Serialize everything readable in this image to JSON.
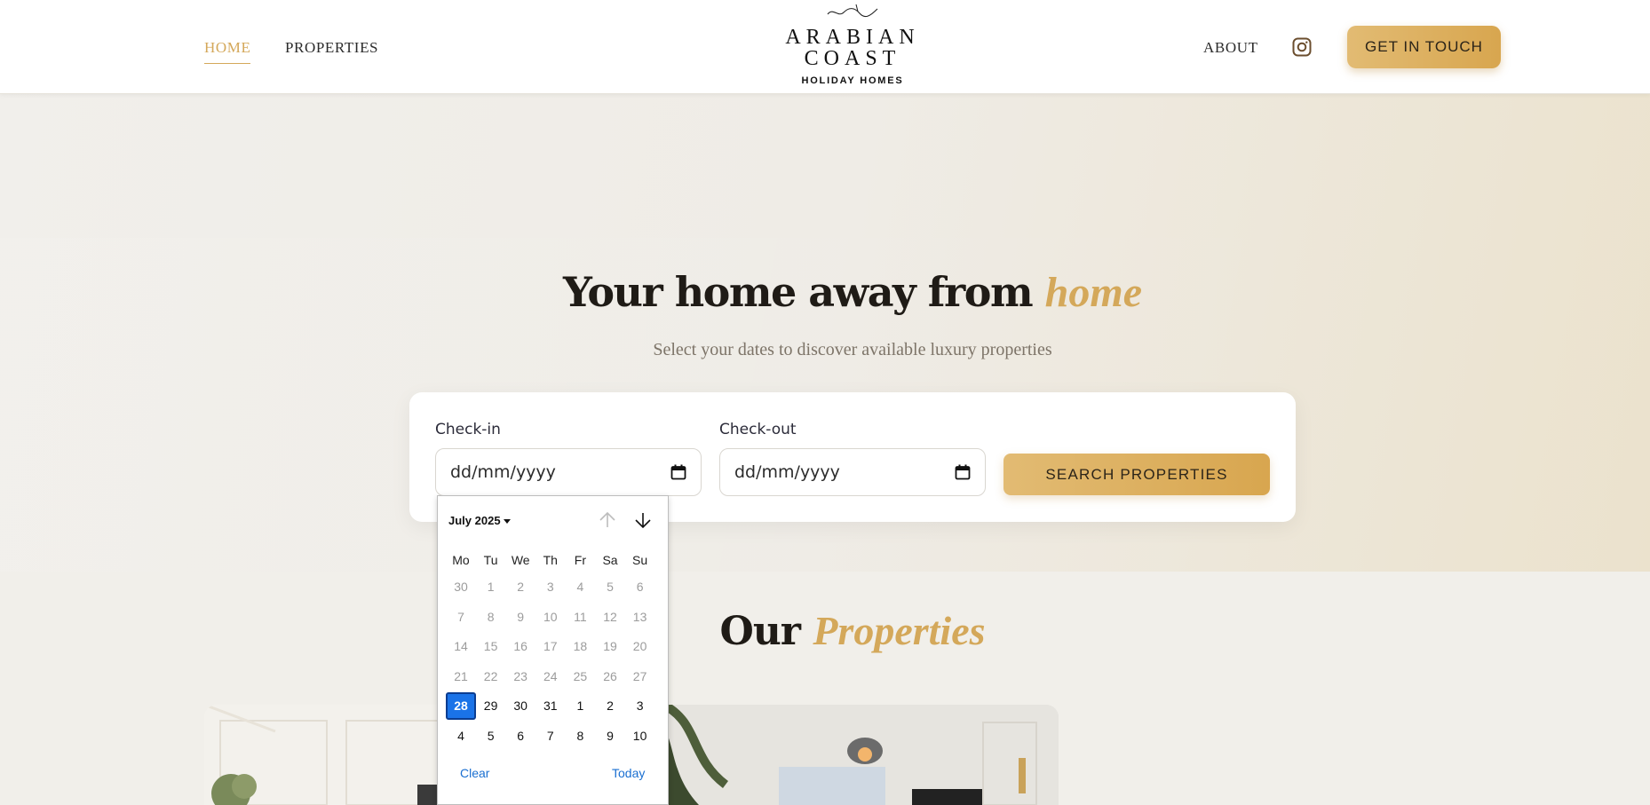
{
  "nav": {
    "home": "HOME",
    "properties": "PROPERTIES",
    "about": "ABOUT",
    "cta": "GET IN TOUCH"
  },
  "logo": {
    "line1": "ARABIAN",
    "line2": "COAST",
    "sub": "HOLIDAY HOMES"
  },
  "hero": {
    "title": "Your home away from ",
    "title_accent": "home",
    "subtitle": "Select your dates to discover available luxury properties"
  },
  "search": {
    "checkin_label": "Check-in",
    "checkout_label": "Check-out",
    "checkin_value": "dd/mm/yyyy",
    "checkout_value": "dd/mm/yyyy",
    "button": "SEARCH PROPERTIES"
  },
  "properties": {
    "title": "Our ",
    "title_accent": "Properties"
  },
  "datepicker": {
    "month": "July 2025",
    "weekdays": [
      "Mo",
      "Tu",
      "We",
      "Th",
      "Fr",
      "Sa",
      "Su"
    ],
    "weeks": [
      [
        "30",
        "1",
        "2",
        "3",
        "4",
        "5",
        "6"
      ],
      [
        "7",
        "8",
        "9",
        "10",
        "11",
        "12",
        "13"
      ],
      [
        "14",
        "15",
        "16",
        "17",
        "18",
        "19",
        "20"
      ],
      [
        "21",
        "22",
        "23",
        "24",
        "25",
        "26",
        "27"
      ],
      [
        "28",
        "29",
        "30",
        "31",
        "1",
        "2",
        "3"
      ],
      [
        "4",
        "5",
        "6",
        "7",
        "8",
        "9",
        "10"
      ]
    ],
    "selected": "28",
    "clear": "Clear",
    "today": "Today"
  },
  "colors": {
    "accent_gold": "#d4a85a",
    "selected_blue": "#1a73e8"
  }
}
